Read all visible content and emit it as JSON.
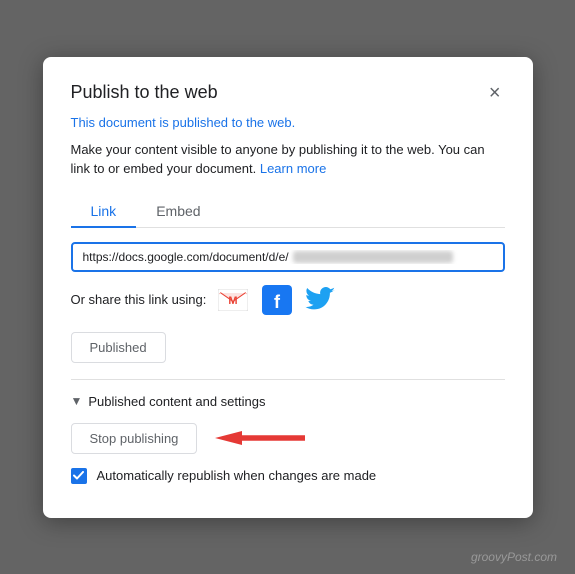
{
  "modal": {
    "title": "Publish to the web",
    "close_label": "×",
    "published_notice": "This document is published to the web.",
    "description": "Make your content visible to anyone by publishing it to the web. You can link to or embed your document.",
    "learn_more": "Learn more",
    "tabs": [
      {
        "label": "Link",
        "active": true
      },
      {
        "label": "Embed",
        "active": false
      }
    ],
    "url_prefix": "https://docs.google.com/document/d/e/",
    "share_label": "Or share this link using:",
    "published_button": "Published",
    "settings_header": "Published content and settings",
    "stop_button": "Stop publishing",
    "checkbox_label": "Automatically republish when changes are made"
  },
  "watermark": "groovyPost.com"
}
